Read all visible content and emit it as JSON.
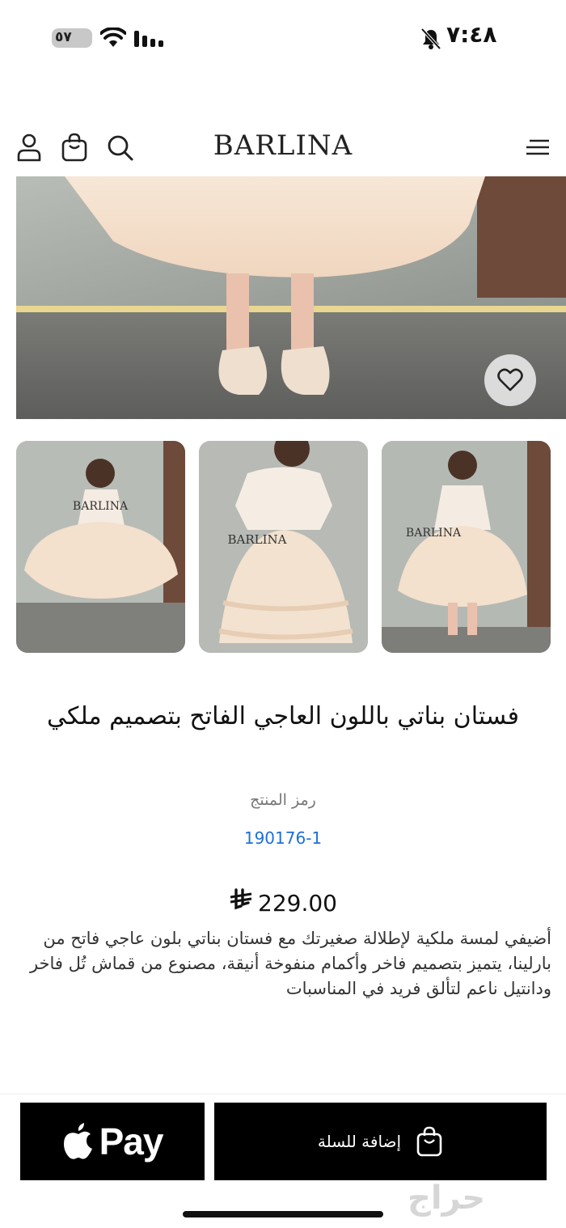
{
  "status_bar": {
    "time": "٧:٤٨",
    "battery": "٥٧"
  },
  "header": {
    "logo": "BARLINA",
    "icons": [
      "user-icon",
      "bag-icon",
      "search-icon",
      "menu-icon"
    ]
  },
  "gallery": {
    "thumbnail_watermark": "BARLINA"
  },
  "product": {
    "title": "فستان بناتي باللون العاجي الفاتح بتصميم ملكي",
    "sku_label": "رمز المنتج",
    "sku": "190176-1",
    "price": "229.00",
    "currency_symbol": "⃁",
    "description": "أضيفي لمسة ملكية لإطلالة صغيرتك مع فستان بناتي بلون عاجي فاتح من بارلينا، يتميز بتصميم فاخر وأكمام منفوخة أنيقة، مصنوع من قماش تُل فاخر ودانتيل ناعم لتألق فريد في المناسبات"
  },
  "actions": {
    "apple_pay_label": "Pay",
    "add_to_cart_label": "إضافة للسلة"
  },
  "watermark": "حراج",
  "colors": {
    "button_bg": "#000000",
    "sku_link": "#1e6fd9"
  }
}
